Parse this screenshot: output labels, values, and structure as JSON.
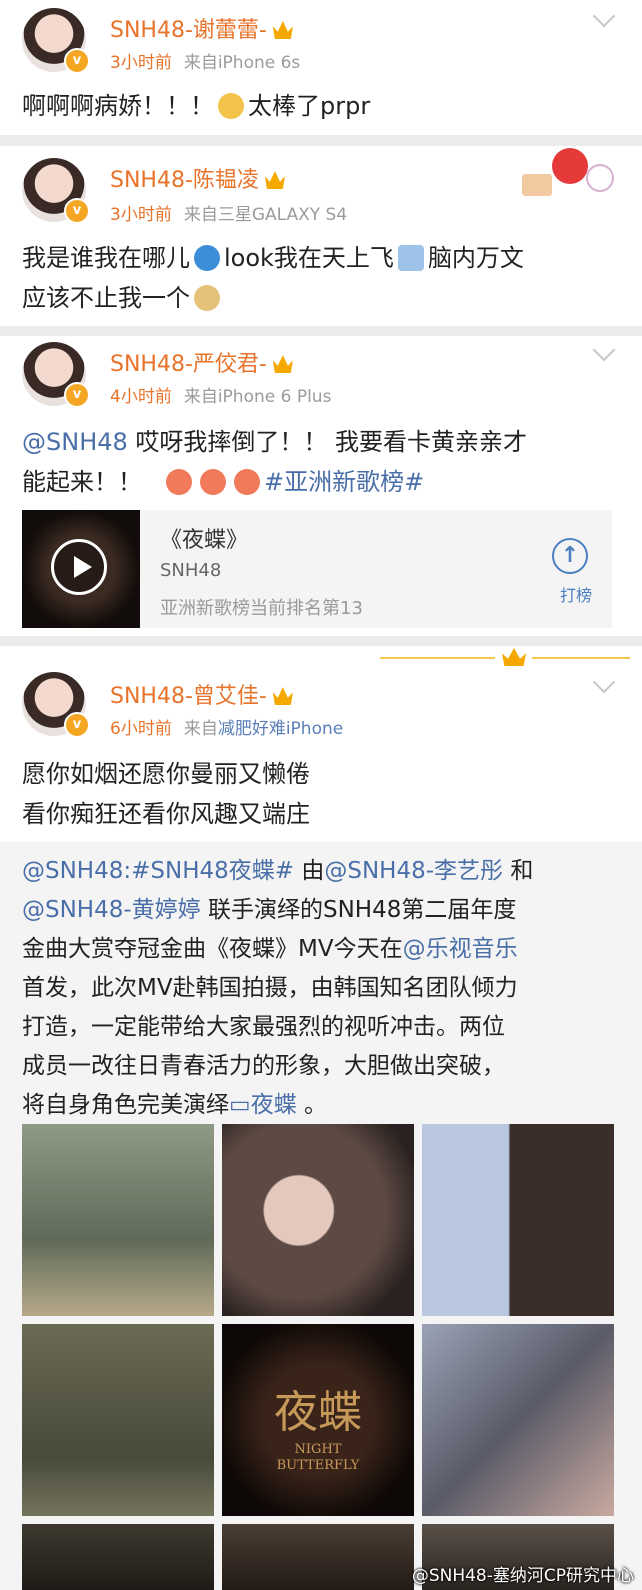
{
  "posts": [
    {
      "name": "SNH48-谢蕾蕾-",
      "time": "3小时前",
      "source": "来自iPhone 6s",
      "text_parts": [
        "啊啊啊病娇！！！",
        "太棒了prpr"
      ]
    },
    {
      "name": "SNH48-陈韫凌",
      "time": "3小时前",
      "source": "来自三星GALAXY S4",
      "line1_parts": [
        "我是谁我在哪儿",
        "look我在天上飞",
        "脑内万文"
      ],
      "line2": "应该不止我一个"
    },
    {
      "name": "SNH48-严佼君-",
      "time": "4小时前",
      "source": "来自iPhone 6 Plus",
      "mention": "@SNH48",
      "line1_rest": " 哎呀我摔倒了！！ 我要看卡黄亲亲才",
      "line2": "能起来！！",
      "topic": "#亚洲新歌榜#",
      "music": {
        "title": "《夜蝶》",
        "artist": "SNH48",
        "rank": "亚洲新歌榜当前排名第13",
        "vote_label": "打榜",
        "vote_icon": "up-arrow-icon"
      }
    },
    {
      "name": "SNH48-曾艾佳-",
      "time": "6小时前",
      "source_prefix": "来自",
      "source_link": "减肥好难iPhone",
      "line1": "愿你如烟还愿你曼丽又懒倦",
      "line2": "看你痴狂还看你风趣又端庄",
      "repost": {
        "l1": [
          "@SNH48:",
          "#SNH48夜蝶#",
          " 由",
          "@SNH48-李艺彤",
          " 和"
        ],
        "l2": [
          "@SNH48-黄婷婷",
          " 联手演绎的SNH48第二届年度"
        ],
        "l3": [
          "金曲大赏夺冠金曲《夜蝶》MV今天在",
          "@乐视音乐"
        ],
        "l4": "首发，此次MV赴韩国拍摄，由韩国知名团队倾力",
        "l5": "打造，一定能带给大家最强烈的视听冲击。两位",
        "l6": "成员一改往日青春活力的形象，大胆做出突破，",
        "l7": [
          "将自身角色完美演绎",
          "夜蝶",
          " 。"
        ]
      }
    }
  ],
  "grid_caption": [
    "夜蝶",
    "NIGHT",
    "BUTTERFLY"
  ],
  "watermark": "@SNH48-塞纳河CP研究中心",
  "colors": {
    "name": "#e8732b",
    "link": "#4a6fa8",
    "accent": "#f4a800"
  }
}
